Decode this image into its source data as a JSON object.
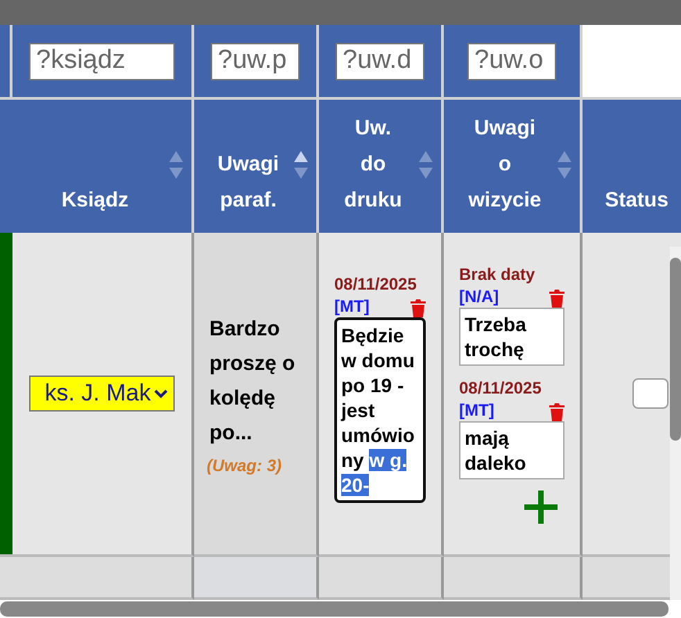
{
  "filters": [
    {
      "placeholder": "?ksiądz"
    },
    {
      "placeholder": "?uw.p"
    },
    {
      "placeholder": "?uw.d"
    },
    {
      "placeholder": "?uw.o"
    }
  ],
  "columns": [
    {
      "label": "Ksiądz",
      "sorted": false
    },
    {
      "label": "Uwagi paraf.",
      "sorted": true
    },
    {
      "label": "Uw. do druku",
      "sorted": false
    },
    {
      "label": "Uwagi o wizycie",
      "sorted": false
    },
    {
      "label": "Status"
    }
  ],
  "row": {
    "priest": "ks. J. Mak",
    "parish_note": "Bardzo proszę o kolędę po...",
    "note_count": "(Uwag: 3)",
    "print_notes": [
      {
        "date": "08/11/2025",
        "author": "[MT]",
        "text": "Będzie w domu po 19 - jest umówiony ",
        "selected_text": "w g. 20-",
        "focused": true
      }
    ],
    "visit_notes": [
      {
        "date": "Brak daty",
        "author": "[N/A]",
        "text": "Trzeba trochę",
        "focused": false
      },
      {
        "date": "08/11/2025",
        "author": "[MT]",
        "text": "mają daleko",
        "focused": false
      }
    ]
  }
}
